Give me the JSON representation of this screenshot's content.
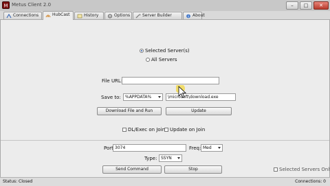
{
  "window": {
    "title": "Metus Client 2.0",
    "minimize_glyph": "–",
    "maximize_glyph": "□",
    "close_glyph": "✕",
    "close_color": "#c0392b"
  },
  "tabs": [
    {
      "label": "Connections",
      "icon": "connections-icon"
    },
    {
      "label": "HubCast",
      "icon": "hubcast-icon",
      "active": true
    },
    {
      "label": "History",
      "icon": "history-icon"
    },
    {
      "label": "Options",
      "icon": "options-icon"
    },
    {
      "label": "Server Builder",
      "icon": "server-builder-icon"
    },
    {
      "label": "About",
      "icon": "about-icon"
    }
  ],
  "hubcast": {
    "target": {
      "selected_label": "Selected Server(s)",
      "all_label": "All Servers",
      "selected_checked": true
    },
    "file_url": {
      "label": "File URL:",
      "value": ""
    },
    "save_to": {
      "label": "Save to:",
      "folder_value": "%APPDATA%",
      "filename_value": "\\microsoft\\download.exe"
    },
    "download_run_button": "Download File and Run",
    "update_button": "Update",
    "options": {
      "dl_exec_label": "DL/Exec on Join",
      "update_join_label": "Update on Join"
    }
  },
  "flood": {
    "port_label": "Port:",
    "port_value": "3074",
    "freq_label": "Freq:",
    "freq_value": "Med",
    "type_label": "Type:",
    "type_value": "SSYN",
    "send_button": "Send Command",
    "stop_button": "Stop"
  },
  "selected_servers_only_label": "Selected Servers Only",
  "status": {
    "text": "Status: Closed",
    "connections": "Connections: 0"
  },
  "colors": {
    "accent": "#1d4e9e",
    "window_bg": "#ececec"
  }
}
